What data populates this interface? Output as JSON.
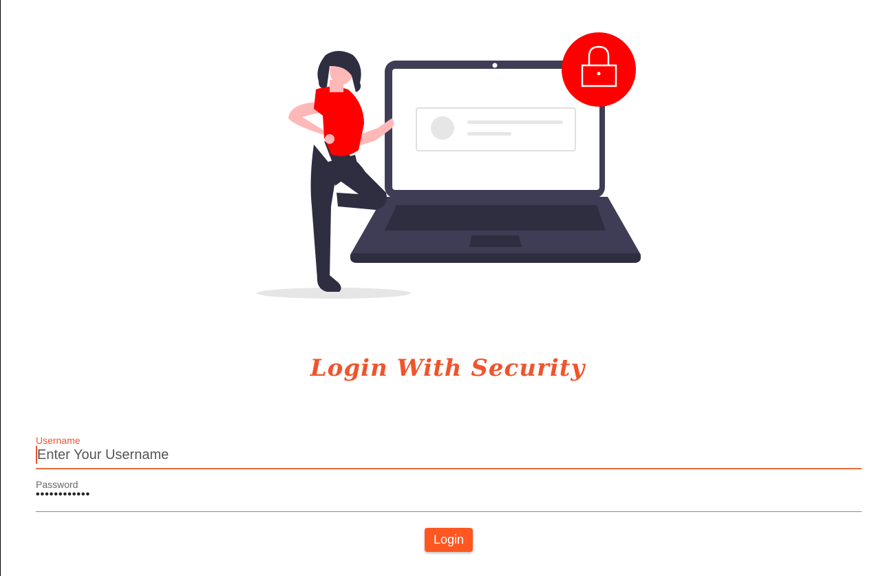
{
  "page": {
    "title": "Login With Security"
  },
  "form": {
    "username": {
      "label": "Username",
      "placeholder": "Enter Your Username",
      "value": ""
    },
    "password": {
      "label": "Password",
      "value": "••••••••••••"
    },
    "login_label": "Login"
  },
  "illustration": {
    "icon": "padlock-icon",
    "description_icons": [
      "person-illustration",
      "laptop-illustration",
      "lock-badge-icon"
    ]
  },
  "colors": {
    "accent": "#f0542c",
    "button": "#ff5722",
    "lock_badge": "#ff0000",
    "laptop": "#3f3d56",
    "person_shirt": "#ff0000"
  }
}
